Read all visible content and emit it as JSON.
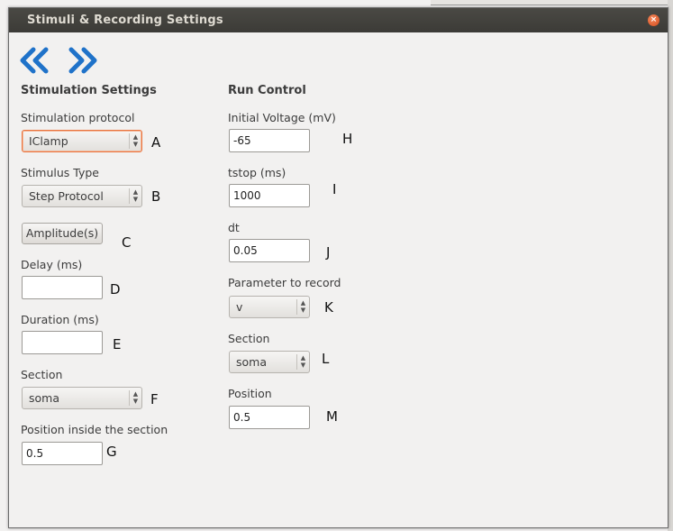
{
  "window": {
    "title": "Stimuli & Recording Settings",
    "close_glyph": "×"
  },
  "nav": {
    "back_icon": "double-chevron-left-icon",
    "forward_icon": "double-chevron-right-icon",
    "color": "#1f72c9"
  },
  "stim": {
    "heading": "Stimulation Settings",
    "protocol_label": "Stimulation protocol",
    "protocol_value": "IClamp",
    "protocol_letter": "A",
    "type_label": "Stimulus Type",
    "type_value": "Step Protocol",
    "type_letter": "B",
    "amplitude_button": "Amplitude(s)",
    "amplitude_letter": "C",
    "delay_label": "Delay (ms)",
    "delay_value": "",
    "delay_letter": "D",
    "duration_label": "Duration (ms)",
    "duration_value": "",
    "duration_letter": "E",
    "section_label": "Section",
    "section_value": "soma",
    "section_letter": "F",
    "position_label": "Position inside the section",
    "position_value": "0.5",
    "position_letter": "G"
  },
  "run": {
    "heading": "Run Control",
    "voltage_label": "Initial Voltage (mV)",
    "voltage_value": "-65",
    "voltage_letter": "H",
    "tstop_label": "tstop (ms)",
    "tstop_value": "1000",
    "tstop_letter": "I",
    "dt_label": "dt",
    "dt_value": "0.05",
    "dt_letter": "J",
    "param_label": "Parameter to record",
    "param_value": "v",
    "param_letter": "K",
    "section_label": "Section",
    "section_value": "soma",
    "section_letter": "L",
    "position_label": "Position",
    "position_value": "0.5",
    "position_letter": "M"
  },
  "colors": {
    "focus_accent": "#e9743f",
    "titlebar": "#3c3b37"
  }
}
